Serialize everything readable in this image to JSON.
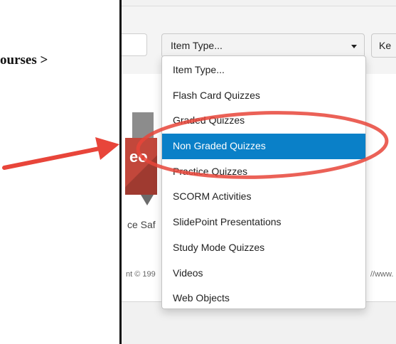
{
  "breadcrumb": {
    "fragment": "ourses >"
  },
  "toolbar": {
    "item_type_select_value": "Item Type...",
    "next_control_label": "Ke"
  },
  "dropdown": {
    "items": [
      {
        "label": "Item Type..."
      },
      {
        "label": "Flash Card Quizzes"
      },
      {
        "label": "Graded Quizzes"
      },
      {
        "label": "Non Graded Quizzes",
        "selected": true
      },
      {
        "label": "Practice Quizzes"
      },
      {
        "label": "SCORM Activities"
      },
      {
        "label": "SlidePoint Presentations"
      },
      {
        "label": "Study Mode Quizzes"
      },
      {
        "label": "Videos"
      },
      {
        "label": "Web Objects"
      }
    ]
  },
  "course": {
    "thumbnail_text": "eo",
    "caption": "ce Saf"
  },
  "footer": {
    "copyright": "nt © 199",
    "link": "//www."
  },
  "colors": {
    "accent": "#0a80c8",
    "annotation": "#e8453a",
    "thumbnail": "#c2473b"
  }
}
